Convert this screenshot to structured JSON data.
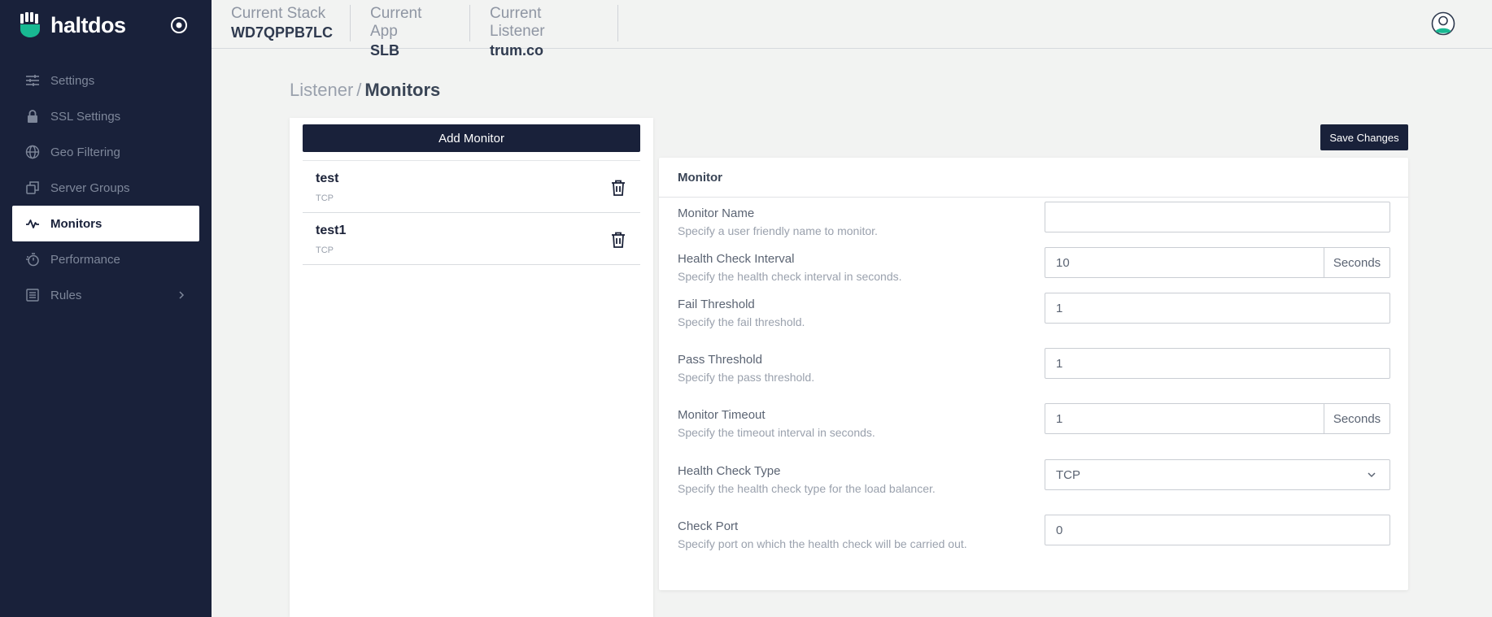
{
  "brand": {
    "name": "haltdos"
  },
  "sidebar": {
    "items": [
      {
        "label": "Settings",
        "icon": "sliders-icon"
      },
      {
        "label": "SSL Settings",
        "icon": "lock-icon"
      },
      {
        "label": "Geo Filtering",
        "icon": "globe-icon"
      },
      {
        "label": "Server Groups",
        "icon": "copy-icon"
      },
      {
        "label": "Monitors",
        "icon": "activity-icon",
        "active": true
      },
      {
        "label": "Performance",
        "icon": "stopwatch-icon"
      },
      {
        "label": "Rules",
        "icon": "list-icon",
        "expandable": true
      }
    ]
  },
  "header": {
    "stack": {
      "label": "Current Stack",
      "value": "WD7QPPB7LC"
    },
    "app": {
      "label": "Current App",
      "value": "SLB"
    },
    "listener": {
      "label": "Current Listener",
      "value": "trum.co"
    }
  },
  "breadcrumb": {
    "parent": "Listener",
    "separator": "/",
    "current": "Monitors"
  },
  "left_panel": {
    "add_label": "Add Monitor",
    "monitors": [
      {
        "name": "test",
        "type": "TCP"
      },
      {
        "name": "test1",
        "type": "TCP"
      }
    ]
  },
  "save_label": "Save Changes",
  "form": {
    "title": "Monitor",
    "monitor_name": {
      "label": "Monitor Name",
      "help": "Specify a user friendly name to monitor.",
      "value": ""
    },
    "interval": {
      "label": "Health Check Interval",
      "help": "Specify the health check interval in seconds.",
      "value": "10",
      "unit": "Seconds"
    },
    "fail": {
      "label": "Fail Threshold",
      "help": "Specify the fail threshold.",
      "value": "1"
    },
    "pass": {
      "label": "Pass Threshold",
      "help": "Specify the pass threshold.",
      "value": "1"
    },
    "timeout": {
      "label": "Monitor Timeout",
      "help": "Specify the timeout interval in seconds.",
      "value": "1",
      "unit": "Seconds"
    },
    "check_type": {
      "label": "Health Check Type",
      "help": "Specify the health check type for the load balancer.",
      "value": "TCP"
    },
    "check_port": {
      "label": "Check Port",
      "help": "Specify port on which the health check will be carried out.",
      "value": "0"
    }
  },
  "colors": {
    "sidebar_bg": "#19213a",
    "accent": "#18b892",
    "page_bg": "#f2f3f2"
  }
}
